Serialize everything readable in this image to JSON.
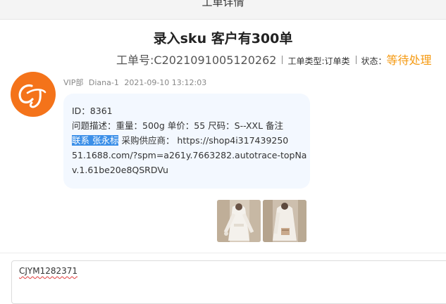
{
  "header": {
    "title": "工单详情"
  },
  "ticket": {
    "title": "录入sku 客户有300单",
    "number_label": "工单号:",
    "number": "C2021091005120262",
    "type_label": "工单类型:",
    "type_value": "订单类",
    "status_label": "状态：",
    "status_value": "等待处理"
  },
  "message": {
    "avatar_text": "CJ",
    "department": "VIP部",
    "author": "Diana-1",
    "timestamp": "2021-09-10 13:12:03",
    "lines": {
      "line1": "ID：8361",
      "line2": "问题描述：重量：500g 单价：55 尺码：S--XXL 备注",
      "line3_highlight": "联系 张永标",
      "line3_rest": " 采购供应商： https://shop4i317439250",
      "line4": "51.1688.com/?spm=a261y.7663282.autotrace-topNa",
      "line5": "v.1.61be20e8QSRDVu"
    },
    "attachments": [
      "photo-1",
      "photo-2"
    ]
  },
  "reply": {
    "value": "CJYM1282371"
  },
  "colors": {
    "accent_orange": "#f59a12",
    "avatar_bg": "#f4731a",
    "bubble_bg": "#f3f8ff",
    "selection": "#3b8fe8"
  }
}
